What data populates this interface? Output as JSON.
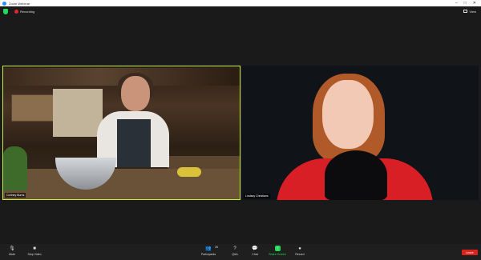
{
  "window": {
    "title": "Zoom Webinar"
  },
  "status": {
    "recording_label": "Recording",
    "view_label": "View"
  },
  "participants": [
    {
      "name": "Cortney Burns",
      "active_speaker": true
    },
    {
      "name": "Lindsay Christians",
      "active_speaker": false
    }
  ],
  "toolbar": {
    "mute": "Mute",
    "stop_video": "Stop Video",
    "participants": "Participants",
    "participants_count": "26",
    "qa": "Q&A",
    "chat": "Chat",
    "share_screen": "Share Screen",
    "record": "Record",
    "leave": "Leave"
  },
  "colors": {
    "active_border": "#c9f03a",
    "share_green": "#23d959",
    "leave_red": "#d9231b"
  }
}
